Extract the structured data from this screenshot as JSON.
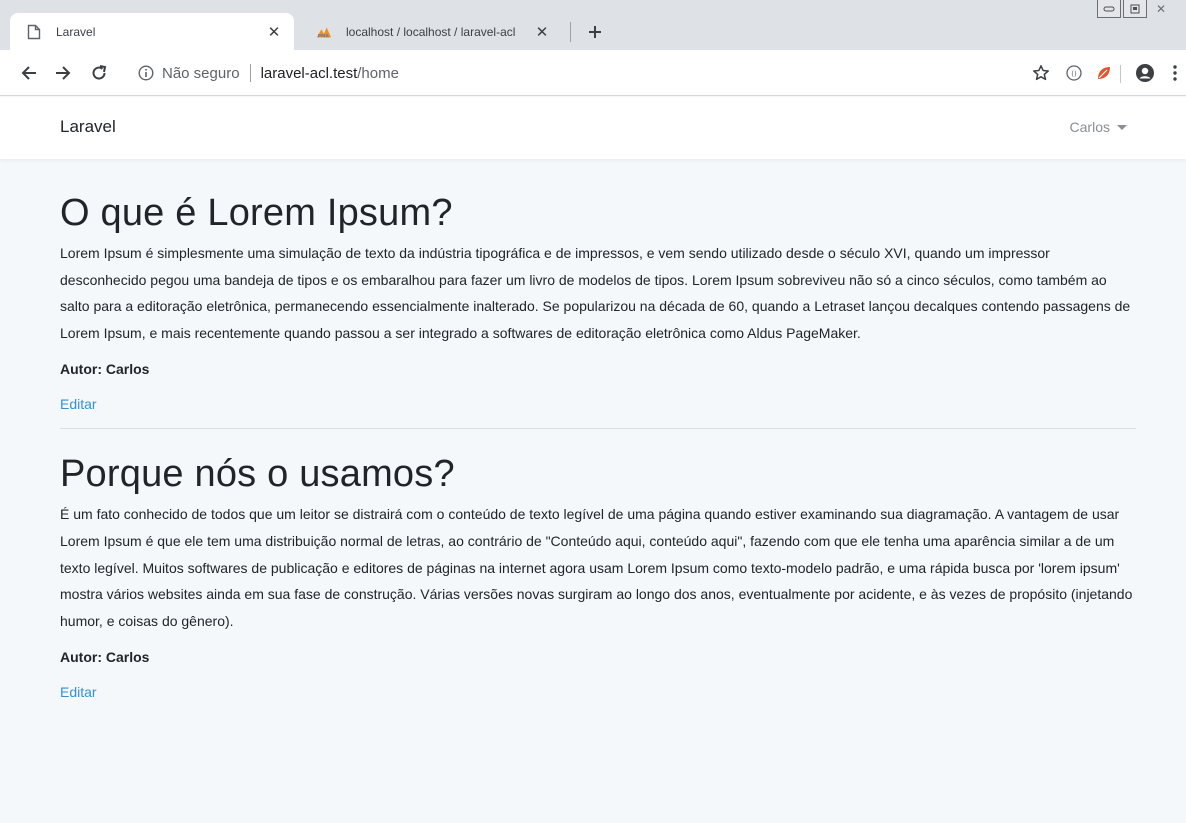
{
  "browser": {
    "tabs": [
      {
        "title": "Laravel",
        "icon": "page-icon",
        "active": true
      },
      {
        "title": "localhost / localhost / laravel-acl",
        "icon": "phpmyadmin-icon",
        "active": false
      }
    ],
    "address_bar": {
      "security_label": "Não seguro",
      "host": "laravel-acl.test",
      "path": "/home"
    }
  },
  "app": {
    "brand": "Laravel",
    "user_name": "Carlos"
  },
  "posts": [
    {
      "title": "O que é Lorem Ipsum?",
      "body": "Lorem Ipsum é simplesmente uma simulação de texto da indústria tipográfica e de impressos, e vem sendo utilizado desde o século XVI, quando um impressor desconhecido pegou uma bandeja de tipos e os embaralhou para fazer um livro de modelos de tipos. Lorem Ipsum sobreviveu não só a cinco séculos, como também ao salto para a editoração eletrônica, permanecendo essencialmente inalterado. Se popularizou na década de 60, quando a Letraset lançou decalques contendo passagens de Lorem Ipsum, e mais recentemente quando passou a ser integrado a softwares de editoração eletrônica como Aldus PageMaker.",
      "author": "Autor: Carlos",
      "edit_label": "Editar"
    },
    {
      "title": "Porque nós o usamos?",
      "body": "É um fato conhecido de todos que um leitor se distrairá com o conteúdo de texto legível de uma página quando estiver examinando sua diagramação. A vantagem de usar Lorem Ipsum é que ele tem uma distribuição normal de letras, ao contrário de \"Conteúdo aqui, conteúdo aqui\", fazendo com que ele tenha uma aparência similar a de um texto legível. Muitos softwares de publicação e editores de páginas na internet agora usam Lorem Ipsum como texto-modelo padrão, e uma rápida busca por 'lorem ipsum' mostra vários websites ainda em sua fase de construção. Várias versões novas surgiram ao longo dos anos, eventualmente por acidente, e às vezes de propósito (injetando humor, e coisas do gênero).",
      "author": "Autor: Carlos",
      "edit_label": "Editar"
    }
  ],
  "colors": {
    "link": "#3490dc",
    "page_background": "#f5f8fa",
    "tabstrip": "#dee1e6"
  }
}
